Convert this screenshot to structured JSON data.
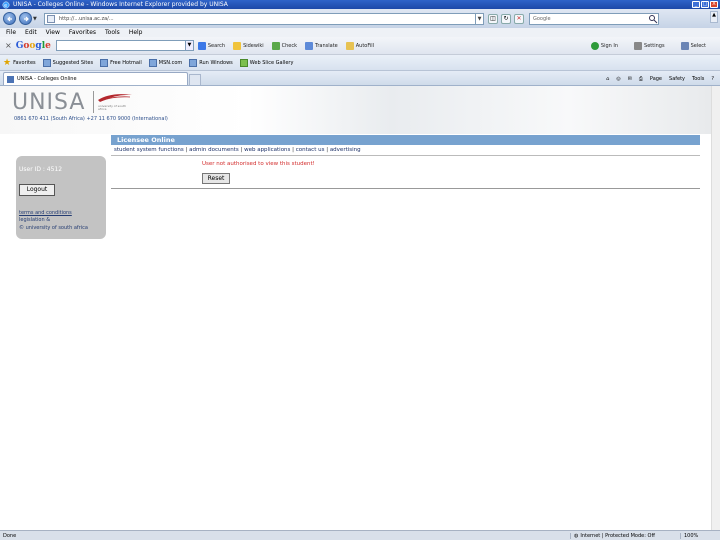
{
  "window": {
    "title": "UNISA - Colleges Online - Windows Internet Explorer provided by UNISA",
    "buttons": [
      "_",
      "□",
      "X"
    ]
  },
  "address_bar": {
    "url": "http://...unisa.ac.za/...",
    "search_placeholder": "Google"
  },
  "menu": {
    "items": [
      "File",
      "Edit",
      "View",
      "Favorites",
      "Tools",
      "Help"
    ]
  },
  "google_toolbar": {
    "logo_letters": [
      "G",
      "o",
      "o",
      "g",
      "l",
      "e"
    ],
    "items": [
      "Search",
      "Sidewiki",
      "Check",
      "Translate",
      "AutoFill"
    ],
    "right_items": [
      "Sign In",
      "Settings",
      "Select"
    ]
  },
  "favorites_bar": {
    "label": "Favorites",
    "items": [
      "Suggested Sites",
      "Free Hotmail",
      "MSN.com",
      "Run Windows",
      "Web Slice Gallery"
    ]
  },
  "tabs": {
    "active": "UNISA - Colleges Online",
    "tools": [
      "Page",
      "Safety",
      "Tools"
    ]
  },
  "page": {
    "brand": "UNISA",
    "crest_tagline": "university of south africa",
    "phone": "0861 670 411 (South Africa) +27 11 670 9000 (International)",
    "user_id": "User ID : 4512",
    "logout_label": "Logout",
    "terms_link": "terms and conditions",
    "legislation": "legislation &",
    "copyright": "© university of south africa",
    "section_title": "Licensee Online",
    "nav": [
      "student system functions",
      "admin documents",
      "web applications",
      "contact us",
      "advertising"
    ],
    "error_message": "User not authorised to view this student!",
    "reset_label": "Reset"
  },
  "status_bar": {
    "left": "Done",
    "zone": "Internet | Protected Mode: Off",
    "zoom": "100%"
  },
  "colors": {
    "titlebar": "#2f63c9",
    "section_bar": "#77a2cf",
    "error": "#d22a2a",
    "left_panel": "#c3c3c3",
    "brand_grey": "#8a8f96",
    "brand_red": "#b3272d"
  }
}
